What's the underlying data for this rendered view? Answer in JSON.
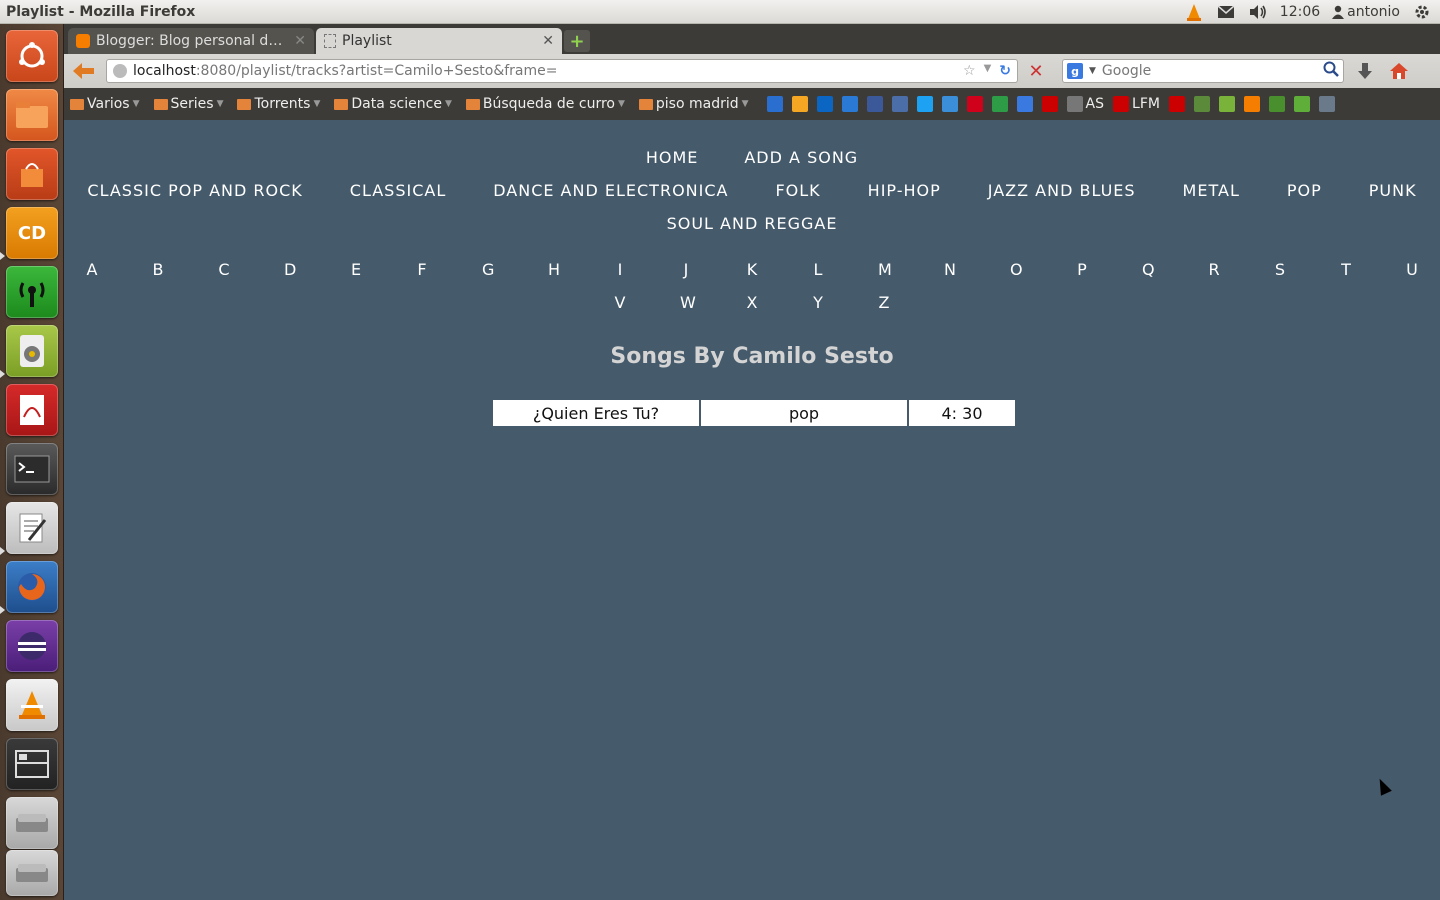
{
  "panel": {
    "window_title": "Playlist - Mozilla Firefox",
    "clock": "12:06",
    "user": "antonio"
  },
  "launcher": {
    "items": [
      "ubuntu-home",
      "files",
      "software-center",
      "cd-burner",
      "network",
      "speakers",
      "document-viewer",
      "terminal",
      "text-editor",
      "firefox",
      "eclipse",
      "vlc",
      "workspaces",
      "disk-1",
      "disk-2"
    ]
  },
  "tabs": [
    {
      "title": "Blogger: Blog personal de A...",
      "active": false
    },
    {
      "title": "Playlist",
      "active": true
    }
  ],
  "navbar": {
    "url_host": "localhost",
    "url_rest": ":8080/playlist/tracks?artist=Camilo+Sesto&frame=",
    "search_placeholder": "Google"
  },
  "bookmarks": {
    "folders": [
      "Varios",
      "Series",
      "Torrents",
      "Data science",
      "Búsqueda de curro",
      "piso madrid"
    ],
    "labels": [
      "AS",
      "LFM"
    ],
    "favicon_colors": [
      "#2a6fcf",
      "#f5a623",
      "#0a66c2",
      "#2a7ad5",
      "#3b5998",
      "#4b6ea8",
      "#1da1f2",
      "#3a8fd8",
      "#d0021b",
      "#2e9b47",
      "#3a7ae0",
      "#cc0000",
      "#777777",
      "#cc0000",
      "#cc0000",
      "#5a8a3a",
      "#7ab33a",
      "#f57d00",
      "#4a8f2e",
      "#5fae3a",
      "#6b7a8a"
    ]
  },
  "page": {
    "main_nav": [
      "HOME",
      "ADD A SONG"
    ],
    "genres": [
      "CLASSIC POP AND ROCK",
      "CLASSICAL",
      "DANCE AND ELECTRONICA",
      "FOLK",
      "HIP-HOP",
      "JAZZ AND BLUES",
      "METAL",
      "POP",
      "PUNK",
      "SOUL AND REGGAE"
    ],
    "letters": [
      "A",
      "B",
      "C",
      "D",
      "E",
      "F",
      "G",
      "H",
      "I",
      "J",
      "K",
      "L",
      "M",
      "N",
      "O",
      "P",
      "Q",
      "R",
      "S",
      "T",
      "U",
      "V",
      "W",
      "X",
      "Y",
      "Z"
    ],
    "title": "Songs By Camilo Sesto",
    "tracks": [
      {
        "title": "¿Quien Eres Tu?",
        "genre": "pop",
        "duration": "4: 30"
      }
    ],
    "background_color": "#455a6b"
  }
}
